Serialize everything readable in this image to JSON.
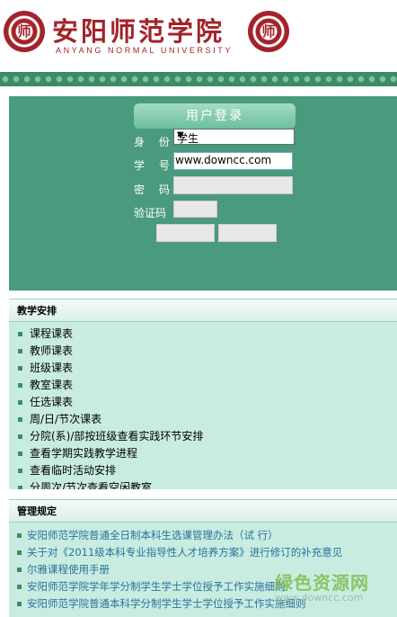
{
  "header": {
    "school_name_cn": "安阳师范学院",
    "school_name_en": "ANYANG NORMAL UNIVERSITY",
    "seal_char": "师"
  },
  "login": {
    "title": "用户登录",
    "identity_label": "身 份",
    "identity_value": "学生",
    "student_id_label": "学 号",
    "student_id_value": "www.downcc.com",
    "password_label": "密 码",
    "captcha_label": "验证码"
  },
  "teaching": {
    "heading": "教学安排",
    "items": [
      "课程课表",
      "教师课表",
      "班级课表",
      "教室课表",
      "任选课表",
      "周/日/节次课表",
      "分院(系)/部按班级查看实践环节安排",
      "查看学期实践教学进程",
      "查看临时活动安排",
      "分周次/节次查看空闲教室"
    ]
  },
  "rules": {
    "heading": "管理规定",
    "items": [
      "安阳师范学院普通全日制本科生选课管理办法（试 行）",
      "关于对《2011级本科专业指导性人才培养方案》进行修订的补充意见",
      "尔雅课程使用手册",
      "安阳师范学院学年学分制学生学士学位授予工作实施细则",
      "安阳师范学院普通本科学分制学生学士学位授予工作实施细则"
    ]
  },
  "watermark": {
    "cn": "绿色资源网",
    "en": "www.downcc.com"
  },
  "colors": {
    "brand_red": "#a3232b",
    "login_bg": "#4a9a7d",
    "panel_bg": "#c8ede0",
    "link": "#2d6f9e"
  }
}
